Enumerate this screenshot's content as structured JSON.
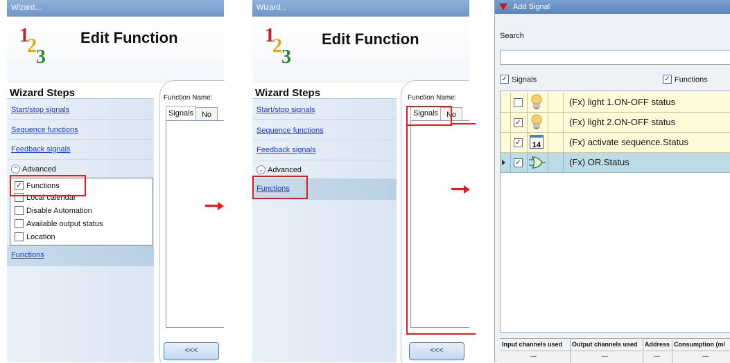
{
  "panel1": {
    "window_title": "Wizard...",
    "header_title": "Edit Function",
    "steps_title": "Wizard Steps",
    "steps": [
      "Start/stop signals",
      "Sequence functions",
      "Feedback signals"
    ],
    "advanced_label": "Advanced",
    "advanced_options": [
      {
        "label": "Functions",
        "checked": true
      },
      {
        "label": "Local calendar",
        "checked": false
      },
      {
        "label": "Disable Automation",
        "checked": false
      },
      {
        "label": "Available output status",
        "checked": false
      },
      {
        "label": "Location",
        "checked": false
      }
    ],
    "selected_step": "Functions",
    "function_name_label": "Function Name:",
    "tabs": [
      "Signals",
      "No"
    ],
    "back_button": "<<<"
  },
  "panel2": {
    "window_title": "Wizard...",
    "header_title": "Edit Function",
    "steps_title": "Wizard Steps",
    "steps": [
      "Start/stop signals",
      "Sequence functions",
      "Feedback signals"
    ],
    "advanced_label": "Advanced",
    "selected_step": "Functions",
    "function_name_label": "Function Name:",
    "tabs": [
      "Signals",
      "No"
    ],
    "back_button": "<<<"
  },
  "add_signal": {
    "title": "Add Signal",
    "search_label": "Search",
    "search_value": "",
    "filters": [
      {
        "label": "Signals",
        "checked": true
      },
      {
        "label": "Functions",
        "checked": true
      }
    ],
    "rows": [
      {
        "checked": false,
        "icon": "lightbulb-icon",
        "text": "(Fx) light 1.ON-OFF status",
        "selected": false
      },
      {
        "checked": true,
        "icon": "lightbulb-icon",
        "text": "(Fx) light 2.ON-OFF status",
        "selected": false
      },
      {
        "checked": true,
        "icon": "calendar-icon",
        "text": "(Fx) activate sequence.Status",
        "selected": false,
        "icon_text": "14"
      },
      {
        "checked": true,
        "icon": "or-gate-icon",
        "text": "(Fx) OR.Status",
        "selected": true
      }
    ],
    "footer_headers": [
      "Input channels used",
      "Output channels used",
      "Address",
      "Consumption (m/"
    ],
    "footer_values": [
      "---",
      "---",
      "---",
      "---"
    ]
  },
  "colors": {
    "highlight_red": "#e11c1c",
    "title_bar_blue": "#6f96c6",
    "link_blue": "#1f3ad1",
    "row_yellow": "#fffbd9",
    "row_selected": "#bcdde8"
  }
}
